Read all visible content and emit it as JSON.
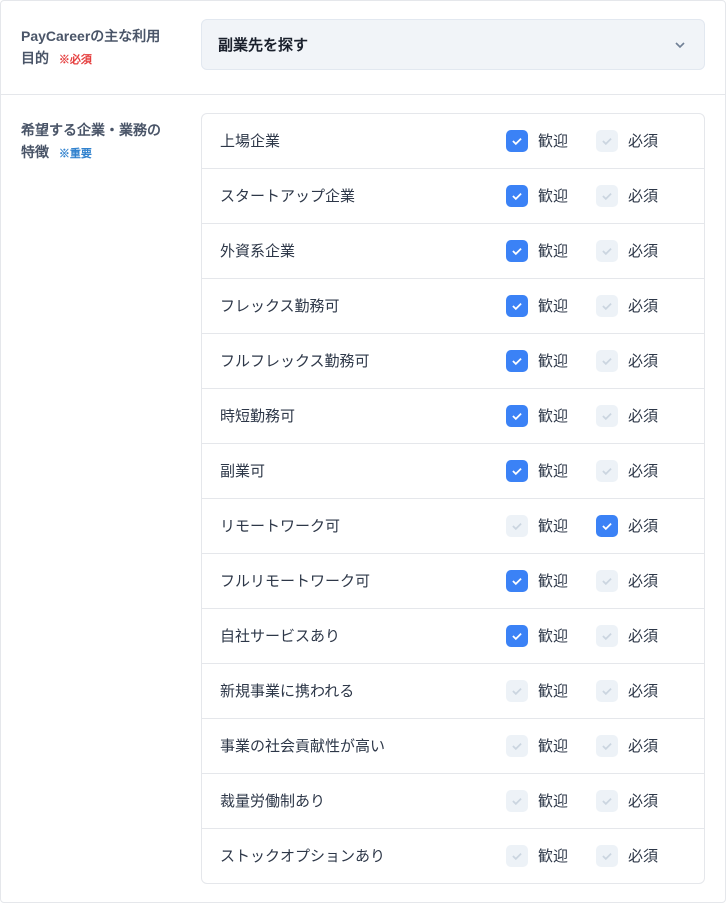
{
  "purpose": {
    "label": "PayCareerの主な利用目的",
    "badge": "※必須",
    "selected": "副業先を探す"
  },
  "features": {
    "label": "希望する企業・業務の特徴",
    "badge": "※重要",
    "welcomeLabel": "歓迎",
    "requiredLabel": "必須",
    "items": [
      {
        "name": "上場企業",
        "welcome": true,
        "required": false
      },
      {
        "name": "スタートアップ企業",
        "welcome": true,
        "required": false
      },
      {
        "name": "外資系企業",
        "welcome": true,
        "required": false
      },
      {
        "name": "フレックス勤務可",
        "welcome": true,
        "required": false
      },
      {
        "name": "フルフレックス勤務可",
        "welcome": true,
        "required": false
      },
      {
        "name": "時短勤務可",
        "welcome": true,
        "required": false
      },
      {
        "name": "副業可",
        "welcome": true,
        "required": false
      },
      {
        "name": "リモートワーク可",
        "welcome": false,
        "required": true
      },
      {
        "name": "フルリモートワーク可",
        "welcome": true,
        "required": false
      },
      {
        "name": "自社サービスあり",
        "welcome": true,
        "required": false
      },
      {
        "name": "新規事業に携われる",
        "welcome": false,
        "required": false
      },
      {
        "name": "事業の社会貢献性が高い",
        "welcome": false,
        "required": false
      },
      {
        "name": "裁量労働制あり",
        "welcome": false,
        "required": false
      },
      {
        "name": "ストックオプションあり",
        "welcome": false,
        "required": false
      }
    ]
  }
}
